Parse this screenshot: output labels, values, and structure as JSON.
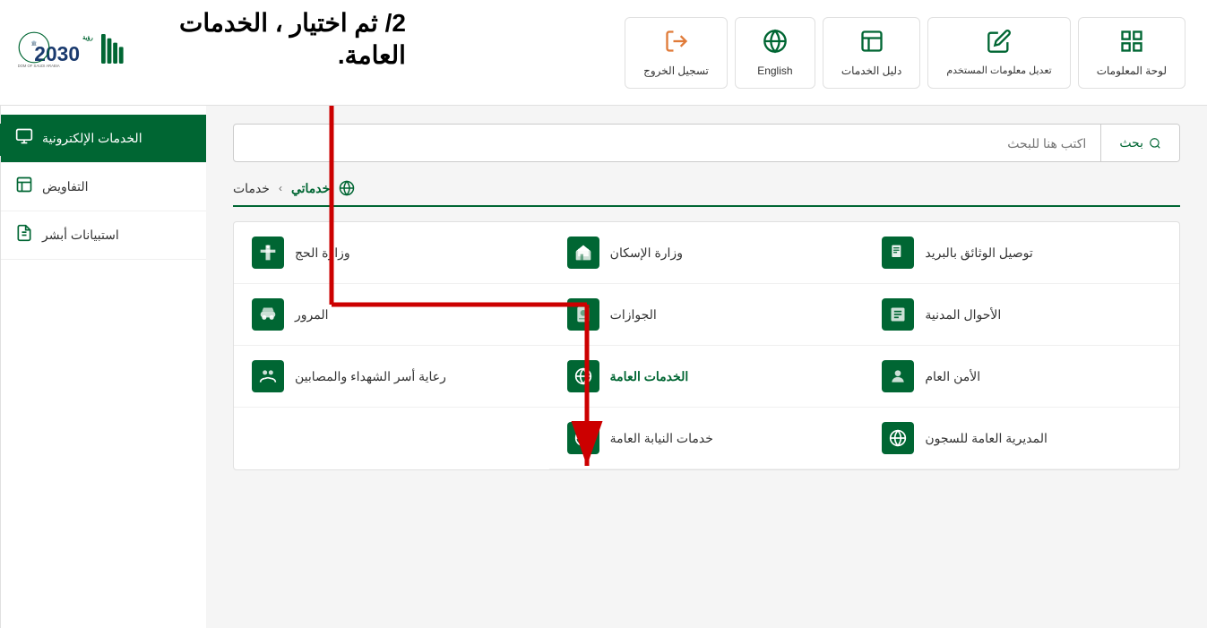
{
  "header": {
    "nav_items": [
      {
        "id": "logout",
        "label": "تسجيل الخروج",
        "icon": "↩"
      },
      {
        "id": "english",
        "label": "English",
        "icon": "🌐"
      },
      {
        "id": "services_guide",
        "label": "دليل الخدمات",
        "icon": "📋"
      },
      {
        "id": "edit_user",
        "label": "تعديل معلومات المستخدم",
        "icon": "✏️"
      },
      {
        "id": "dashboard",
        "label": "لوحة المعلومات",
        "icon": "⊞"
      }
    ]
  },
  "annotation": {
    "line1": "2/ ثم اختيار ، الخدمات",
    "line2": "العامة."
  },
  "search": {
    "button_label": "بحث",
    "placeholder": "اكتب هنا للبحث"
  },
  "breadcrumb": {
    "items": [
      {
        "label": "خدماتي",
        "active": true
      },
      {
        "label": "خدمات",
        "active": false
      }
    ]
  },
  "sidebar": {
    "items": [
      {
        "id": "e-services",
        "label": "الخدمات الإلكترونية",
        "active": true
      },
      {
        "id": "negotiations",
        "label": "التفاويض",
        "active": false
      },
      {
        "id": "absher-surveys",
        "label": "استبيانات أبشر",
        "active": false
      }
    ],
    "toggle_icon": "‹"
  },
  "services": {
    "items": [
      {
        "id": "docs-delivery",
        "label": "توصيل الوثائق بالبريد",
        "icon": "📄"
      },
      {
        "id": "civil-affairs",
        "label": "الأحوال المدنية",
        "icon": "📋"
      },
      {
        "id": "public-security",
        "label": "الأمن العام",
        "icon": "👤"
      },
      {
        "id": "general-prisons",
        "label": "المديرية العامة للسجون",
        "icon": "🌐"
      },
      {
        "id": "housing",
        "label": "وزارة الإسكان",
        "icon": "🏢"
      },
      {
        "id": "passports",
        "label": "الجوازات",
        "icon": "📘"
      },
      {
        "id": "general-services",
        "label": "الخدمات العامة",
        "icon": "🌐"
      },
      {
        "id": "prosecution-services",
        "label": "خدمات النيابة العامة",
        "icon": "🌐"
      },
      {
        "id": "hajj",
        "label": "وزارة الحج",
        "icon": "🕌"
      },
      {
        "id": "traffic",
        "label": "المرور",
        "icon": "🚗"
      },
      {
        "id": "martyrs-care",
        "label": "رعاية أسر الشهداء والمصابين",
        "icon": "👥"
      }
    ]
  },
  "colors": {
    "green": "#006633",
    "orange": "#e07b39",
    "red": "#cc0000",
    "white": "#ffffff"
  }
}
